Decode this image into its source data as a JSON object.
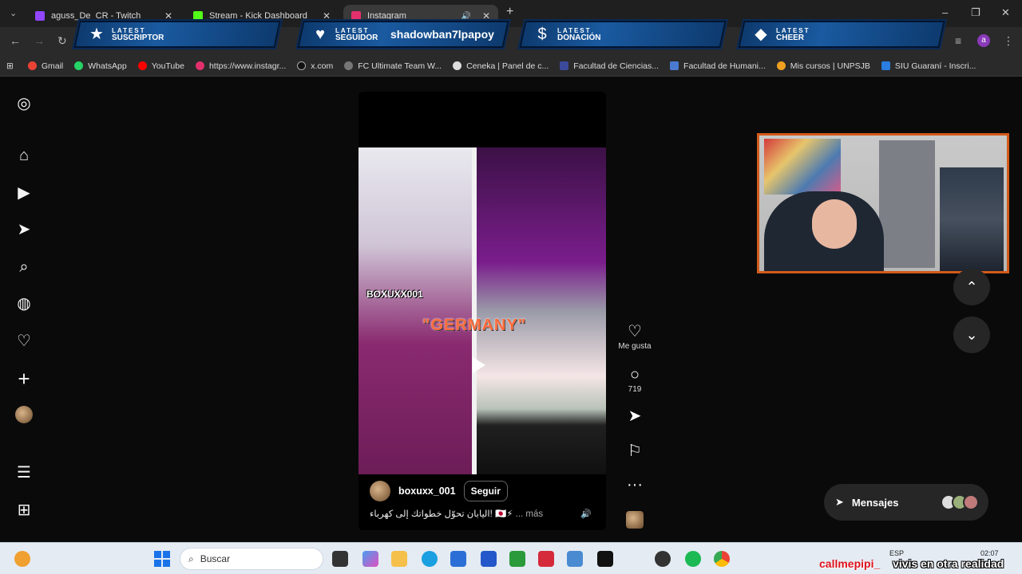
{
  "tabs": [
    {
      "label": "aguss_De_CR - Twitch",
      "color": "#9146ff"
    },
    {
      "label": "Stream - Kick Dashboard",
      "color": "#53fc18"
    },
    {
      "label": "Instagram",
      "color": "#e1306c"
    }
  ],
  "banners": [
    {
      "l1": "LATEST",
      "l2": "SUSCRIPTOR",
      "value": ""
    },
    {
      "l1": "LATEST",
      "l2": "SEGUIDOR",
      "value": "shadowban7lpapoy"
    },
    {
      "l1": "LATEST",
      "l2": "DONACIÓN",
      "value": ""
    },
    {
      "l1": "LATEST",
      "l2": "CHEER",
      "value": ""
    }
  ],
  "bookmarks": [
    {
      "label": "Gmail",
      "color": "#ea4335"
    },
    {
      "label": "WhatsApp",
      "color": "#25d366"
    },
    {
      "label": "YouTube",
      "color": "#ff0000"
    },
    {
      "label": "https://www.instagr...",
      "color": "#e1306c"
    },
    {
      "label": "x.com",
      "color": "#111111"
    },
    {
      "label": "FC Ultimate Team W...",
      "color": "#777777"
    },
    {
      "label": "Ceneka | Panel de c...",
      "color": "#dddddd"
    },
    {
      "label": "Facultad de Ciencias...",
      "color": "#3b4a9a"
    },
    {
      "label": "Facultad de Humani...",
      "color": "#4a7bd0"
    },
    {
      "label": "Mis cursos | UNPSJB",
      "color": "#f0a020"
    },
    {
      "label": "SIU Guaraní - Inscri...",
      "color": "#2a7de1"
    }
  ],
  "reel": {
    "overlay_tag": "BOXUXX001",
    "overlay_text": "\"GERMANY\"",
    "username": "boxuxx_001",
    "follow_label": "Seguir",
    "caption": "اليابان تحوّل خطواتك إلى كهرباء! 🇯🇵⚡",
    "caption_more": "... más"
  },
  "actions": {
    "like_label": "Me gusta",
    "comments_count": "719"
  },
  "messages": {
    "label": "Mensajes"
  },
  "taskbar": {
    "search_placeholder": "Buscar",
    "overlay_red": "callmepipi_",
    "overlay_white": "vivis en otra realidad",
    "lang": "ESP",
    "time": "02:07"
  },
  "colors": {
    "accent_orange": "#d35a1a",
    "banner_blue": "#1a5aa0"
  }
}
